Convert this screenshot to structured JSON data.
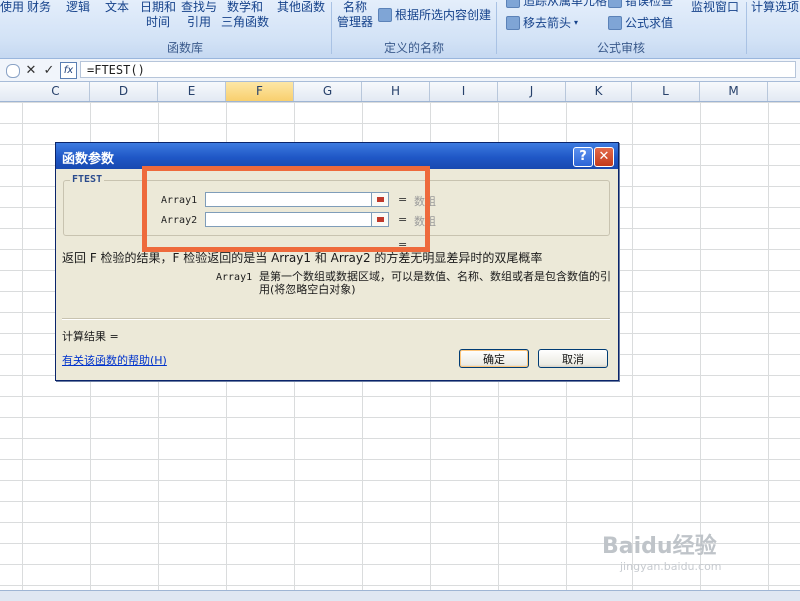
{
  "ribbon": {
    "buttons": [
      {
        "label_top": "使用",
        "label_bottom": ""
      },
      {
        "label_top": "财务",
        "label_bottom": ""
      },
      {
        "label_top": "逻辑",
        "label_bottom": ""
      },
      {
        "label_top": "文本",
        "label_bottom": ""
      },
      {
        "label_top": "日期和",
        "label_bottom": "时间"
      },
      {
        "label_top": "查找与",
        "label_bottom": "引用"
      },
      {
        "label_top": "数学和",
        "label_bottom": "三角函数"
      },
      {
        "label_top": "其他函数",
        "label_bottom": ""
      }
    ],
    "group_function_library": "函数库",
    "name_manager_top": "名称",
    "name_manager_bottom": "管理器",
    "create_from_selection": "根据所选内容创建",
    "group_defined_names": "定义的名称",
    "trace_precedents": "追踪从属单元格",
    "remove_arrows": "移去箭头",
    "error_checking": "错误检查",
    "evaluate_formula": "公式求值",
    "watch_window": "监视窗口",
    "group_formula_auditing": "公式审核",
    "calc_options": "计算选项"
  },
  "formula_bar": {
    "cancel": "✕",
    "enter": "✓",
    "fx": "fx",
    "formula": "=FTEST()"
  },
  "columns": [
    {
      "label": "C"
    },
    {
      "label": "D"
    },
    {
      "label": "E"
    },
    {
      "label": "F"
    },
    {
      "label": "G"
    },
    {
      "label": "H"
    },
    {
      "label": "I"
    },
    {
      "label": "J"
    },
    {
      "label": "K"
    },
    {
      "label": "L"
    },
    {
      "label": "M"
    }
  ],
  "active_column": "F",
  "dialog": {
    "title": "函数参数",
    "help_glyph": "?",
    "close_glyph": "✕",
    "function_name": "FTEST",
    "args": [
      {
        "label": "Array1",
        "eq": "=",
        "value": "数组"
      },
      {
        "label": "Array2",
        "eq": "=",
        "value": "数组"
      }
    ],
    "result_eq": "=",
    "description": "返回 F 检验的结果，F 检验返回的是当 Array1 和 Array2 的方差无明显差异时的双尾概率",
    "arg_desc_name": "Array1",
    "arg_desc_text": "是第一个数组或数据区域，可以是数值、名称、数组或者是包含数值的引用(将忽略空白对象)",
    "result_label": "计算结果 =",
    "help_link": "有关该函数的帮助(H)",
    "ok": "确定",
    "cancel": "取消"
  },
  "colors": {
    "highlight": "#ee6a3c",
    "titlebar": "#1f57c6",
    "active_column": "#f8cf6e"
  },
  "watermark": {
    "main": "Baidu经验",
    "sub": "jingyan.baidu.com"
  }
}
